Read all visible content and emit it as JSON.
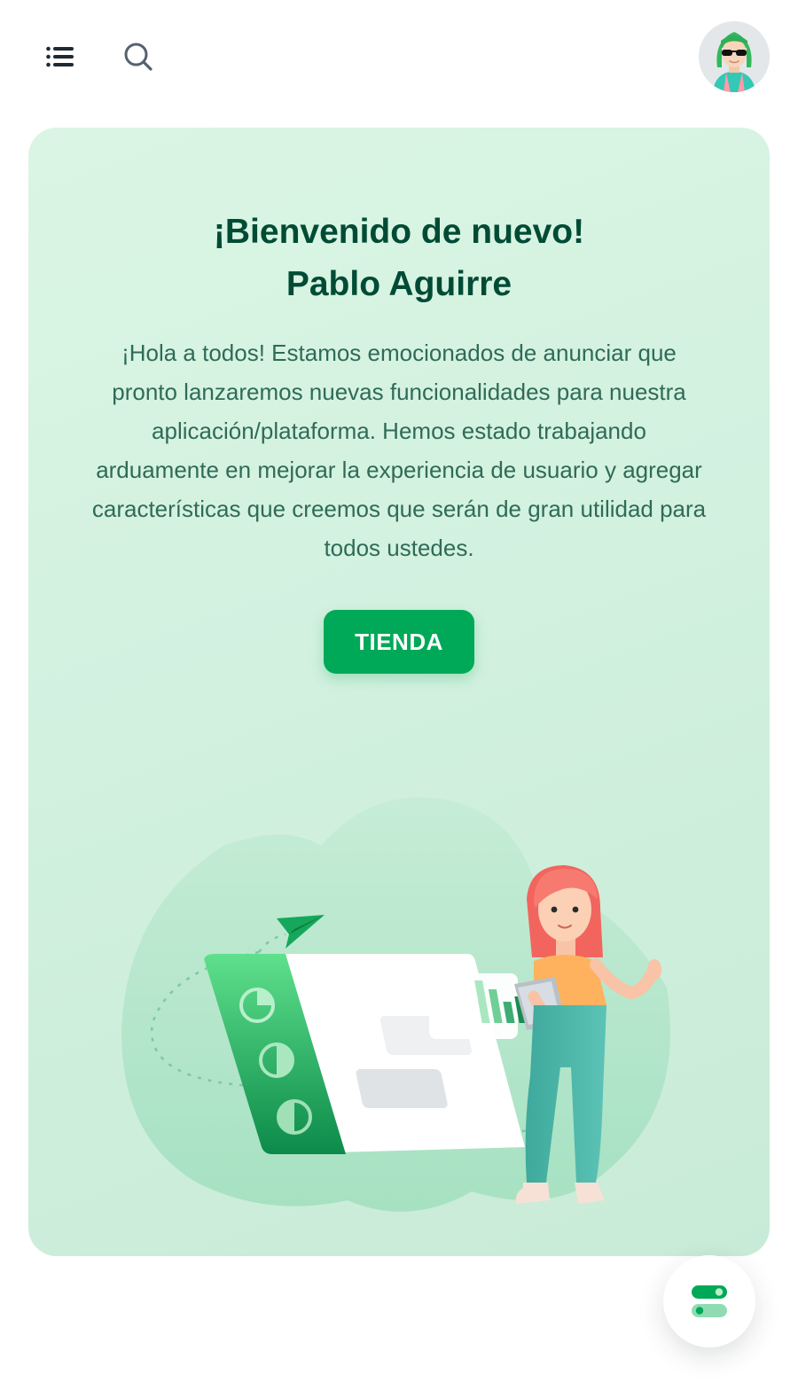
{
  "header": {
    "menu_icon": "menu-icon",
    "search_icon": "search-icon",
    "avatar_icon": "user-avatar"
  },
  "welcome": {
    "title_line1": "¡Bienvenido de nuevo!",
    "title_line2": "Pablo Aguirre",
    "description": "¡Hola a todos! Estamos emocionados de anunciar que pronto lanzaremos nuevas funcionalidades para nuestra aplicación/plataforma. Hemos estado trabajando arduamente en mejorar la experiencia de usuario y agregar características que creemos que serán de gran utilidad para todos ustedes.",
    "button_label": "TIENDA",
    "illustration": "woman-with-tablet-dashboard-illustration"
  },
  "settings_fab": {
    "icon": "toggle-settings-icon"
  },
  "colors": {
    "primary": "#00a957",
    "title": "#004b35",
    "text": "#2f6b57",
    "card_bg": "#d2f1df"
  }
}
